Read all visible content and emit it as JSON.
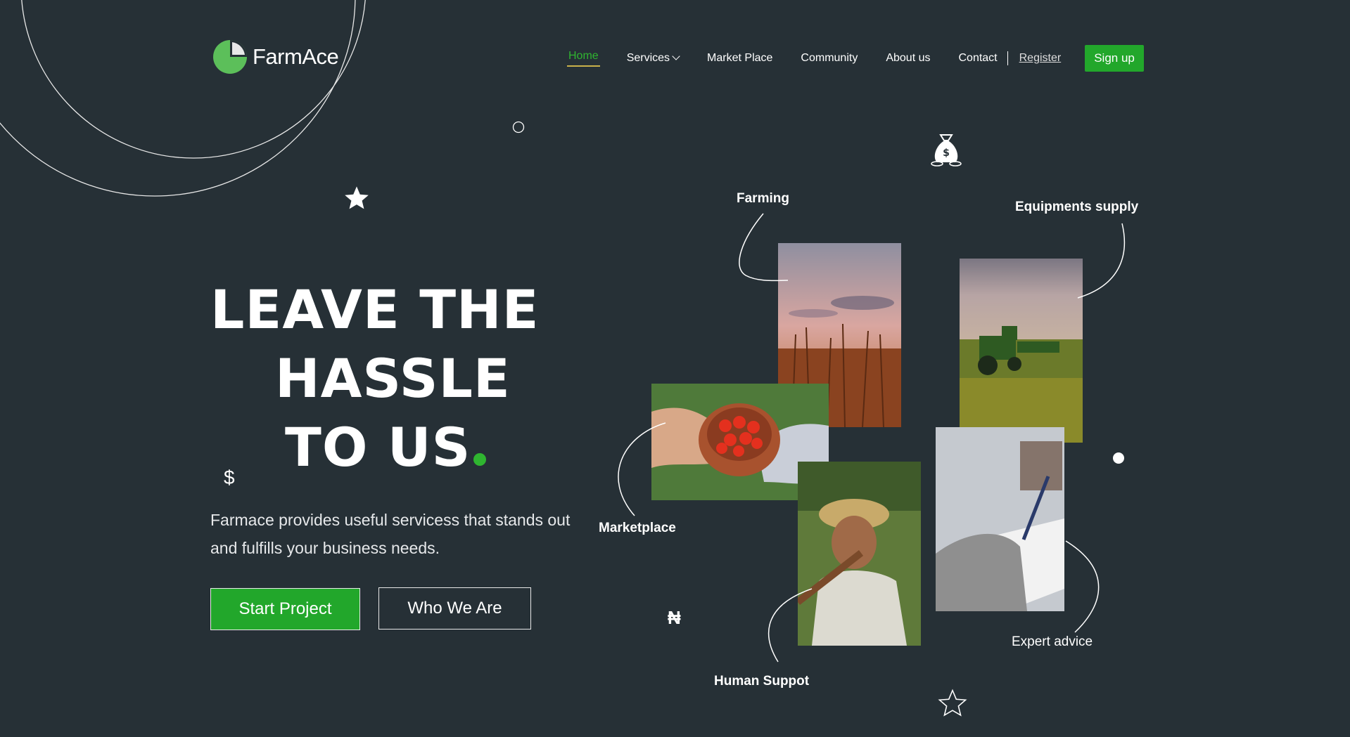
{
  "brand": {
    "name": "FarmAce"
  },
  "nav": {
    "home": "Home",
    "services": "Services",
    "marketplace": "Market Place",
    "community": "Community",
    "about": "About us",
    "contact": "Contact",
    "register": "Register",
    "signup": "Sign up"
  },
  "hero": {
    "line1": "LEAVE THE",
    "line2": "HASSLE",
    "line3": "TO US",
    "description": "Farmace provides useful servicess that stands out and fulfills your business needs.",
    "start_button": "Start Project",
    "who_button": "Who We Are"
  },
  "collage": {
    "farming": "Farming",
    "equipment": "Equipments supply",
    "marketplace": "Marketplace",
    "human": "Human Suppot",
    "expert": "Expert advice"
  },
  "symbols": {
    "dollar": "$",
    "naira": "₦"
  },
  "colors": {
    "background": "#263036",
    "accent": "#22a72b",
    "underline": "#c9b14a"
  }
}
